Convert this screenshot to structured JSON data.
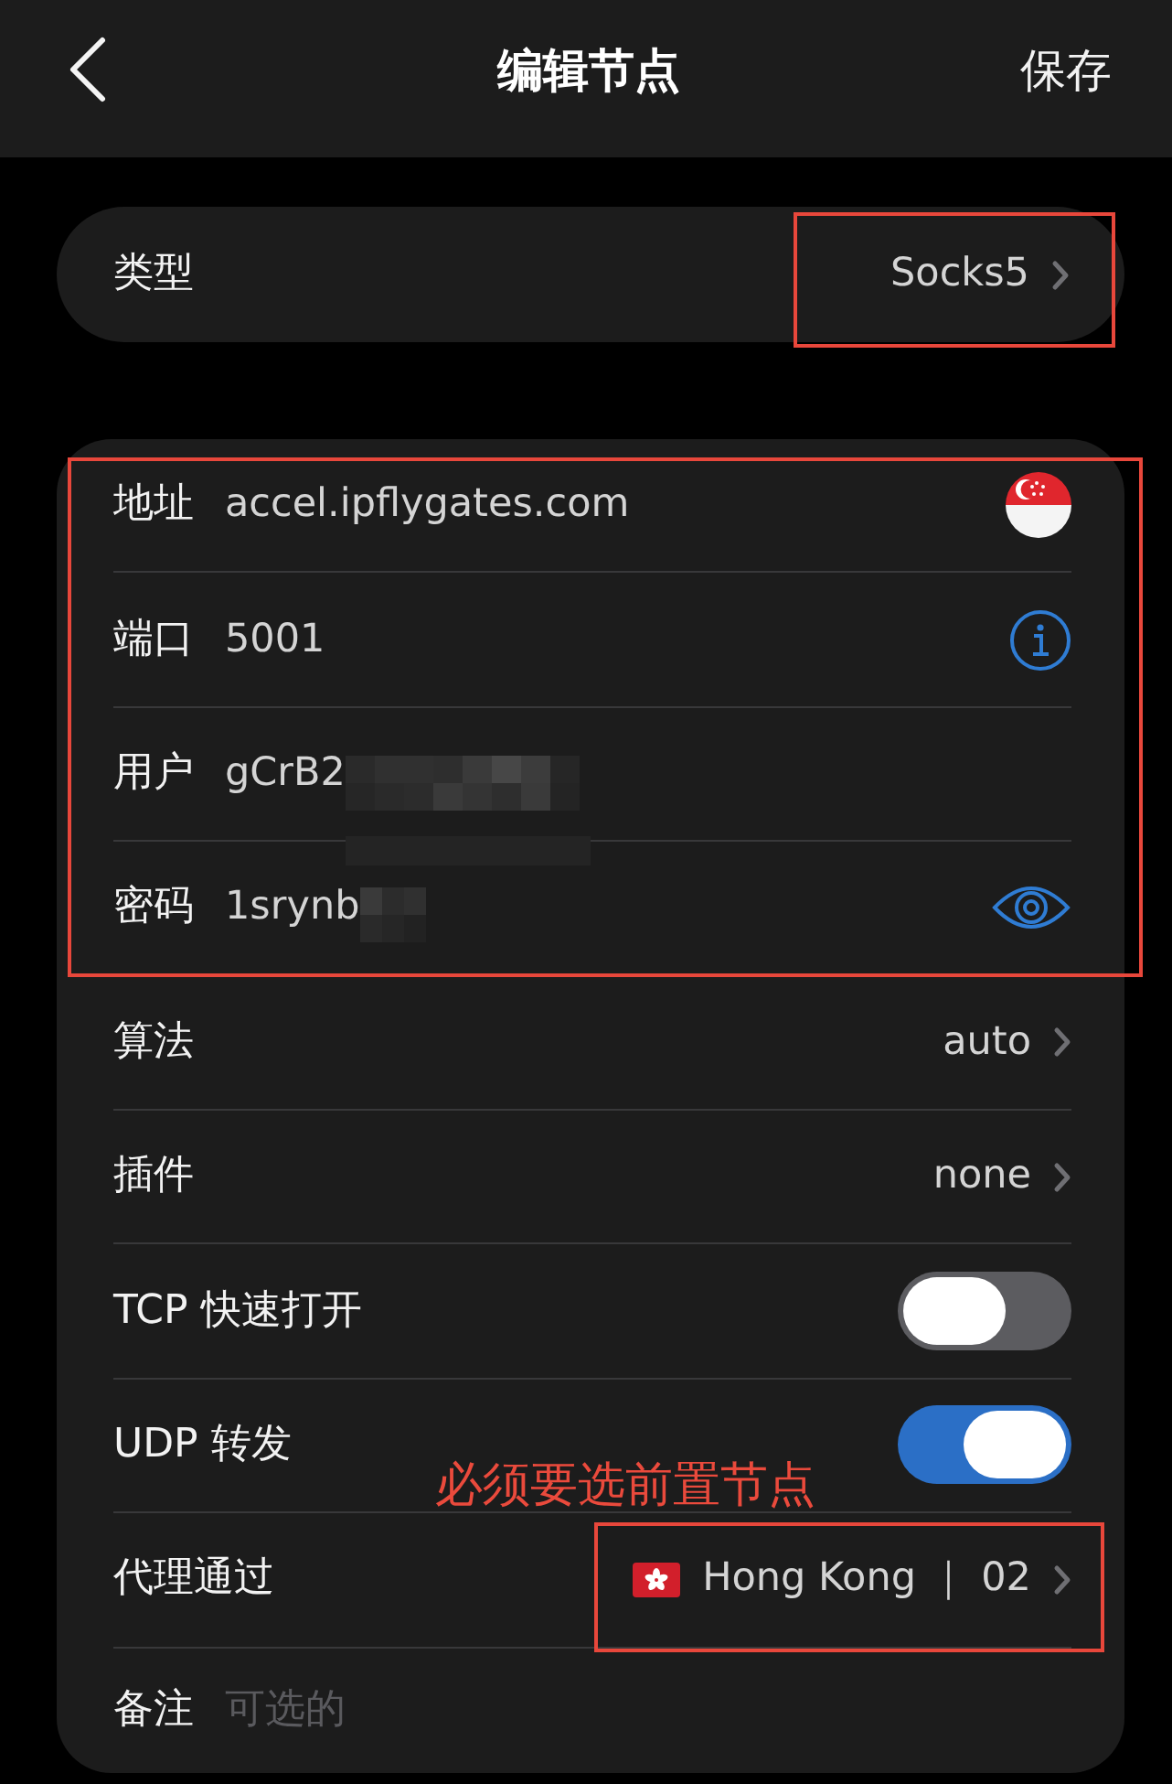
{
  "nav": {
    "title": "编辑节点",
    "action": "保存"
  },
  "type_row": {
    "label": "类型",
    "value": "Socks5",
    "highlighted": true
  },
  "form": {
    "sections": [
      {
        "highlighted": true,
        "rows": [
          {
            "kind": "host",
            "label": "地址",
            "value": "accel.ipflygates.com",
            "redacted": false
          },
          {
            "kind": "port",
            "label": "端口",
            "value": "5001",
            "redacted": false
          },
          {
            "kind": "text",
            "label": "用户",
            "value": "gCrB2",
            "redacted": true
          },
          {
            "kind": "password",
            "label": "密码",
            "value": "1srynb",
            "redacted": true
          }
        ]
      },
      {
        "highlighted": false,
        "rows": [
          {
            "kind": "choice",
            "label": "算法",
            "value": "auto",
            "highlighted": false
          },
          {
            "kind": "choice",
            "label": "插件",
            "value": "none",
            "highlighted": false
          },
          {
            "kind": "toggle",
            "label": "TCP 快速打开",
            "on": false
          },
          {
            "kind": "toggle",
            "label": "UDP 转发",
            "on": true
          },
          {
            "kind": "node",
            "label": "代理通过",
            "value": "Hong Kong ｜ 02",
            "highlighted": true,
            "callout": "必须要选前置节点"
          },
          {
            "kind": "note",
            "label": "备注",
            "placeholder": "可选的"
          }
        ]
      }
    ]
  }
}
